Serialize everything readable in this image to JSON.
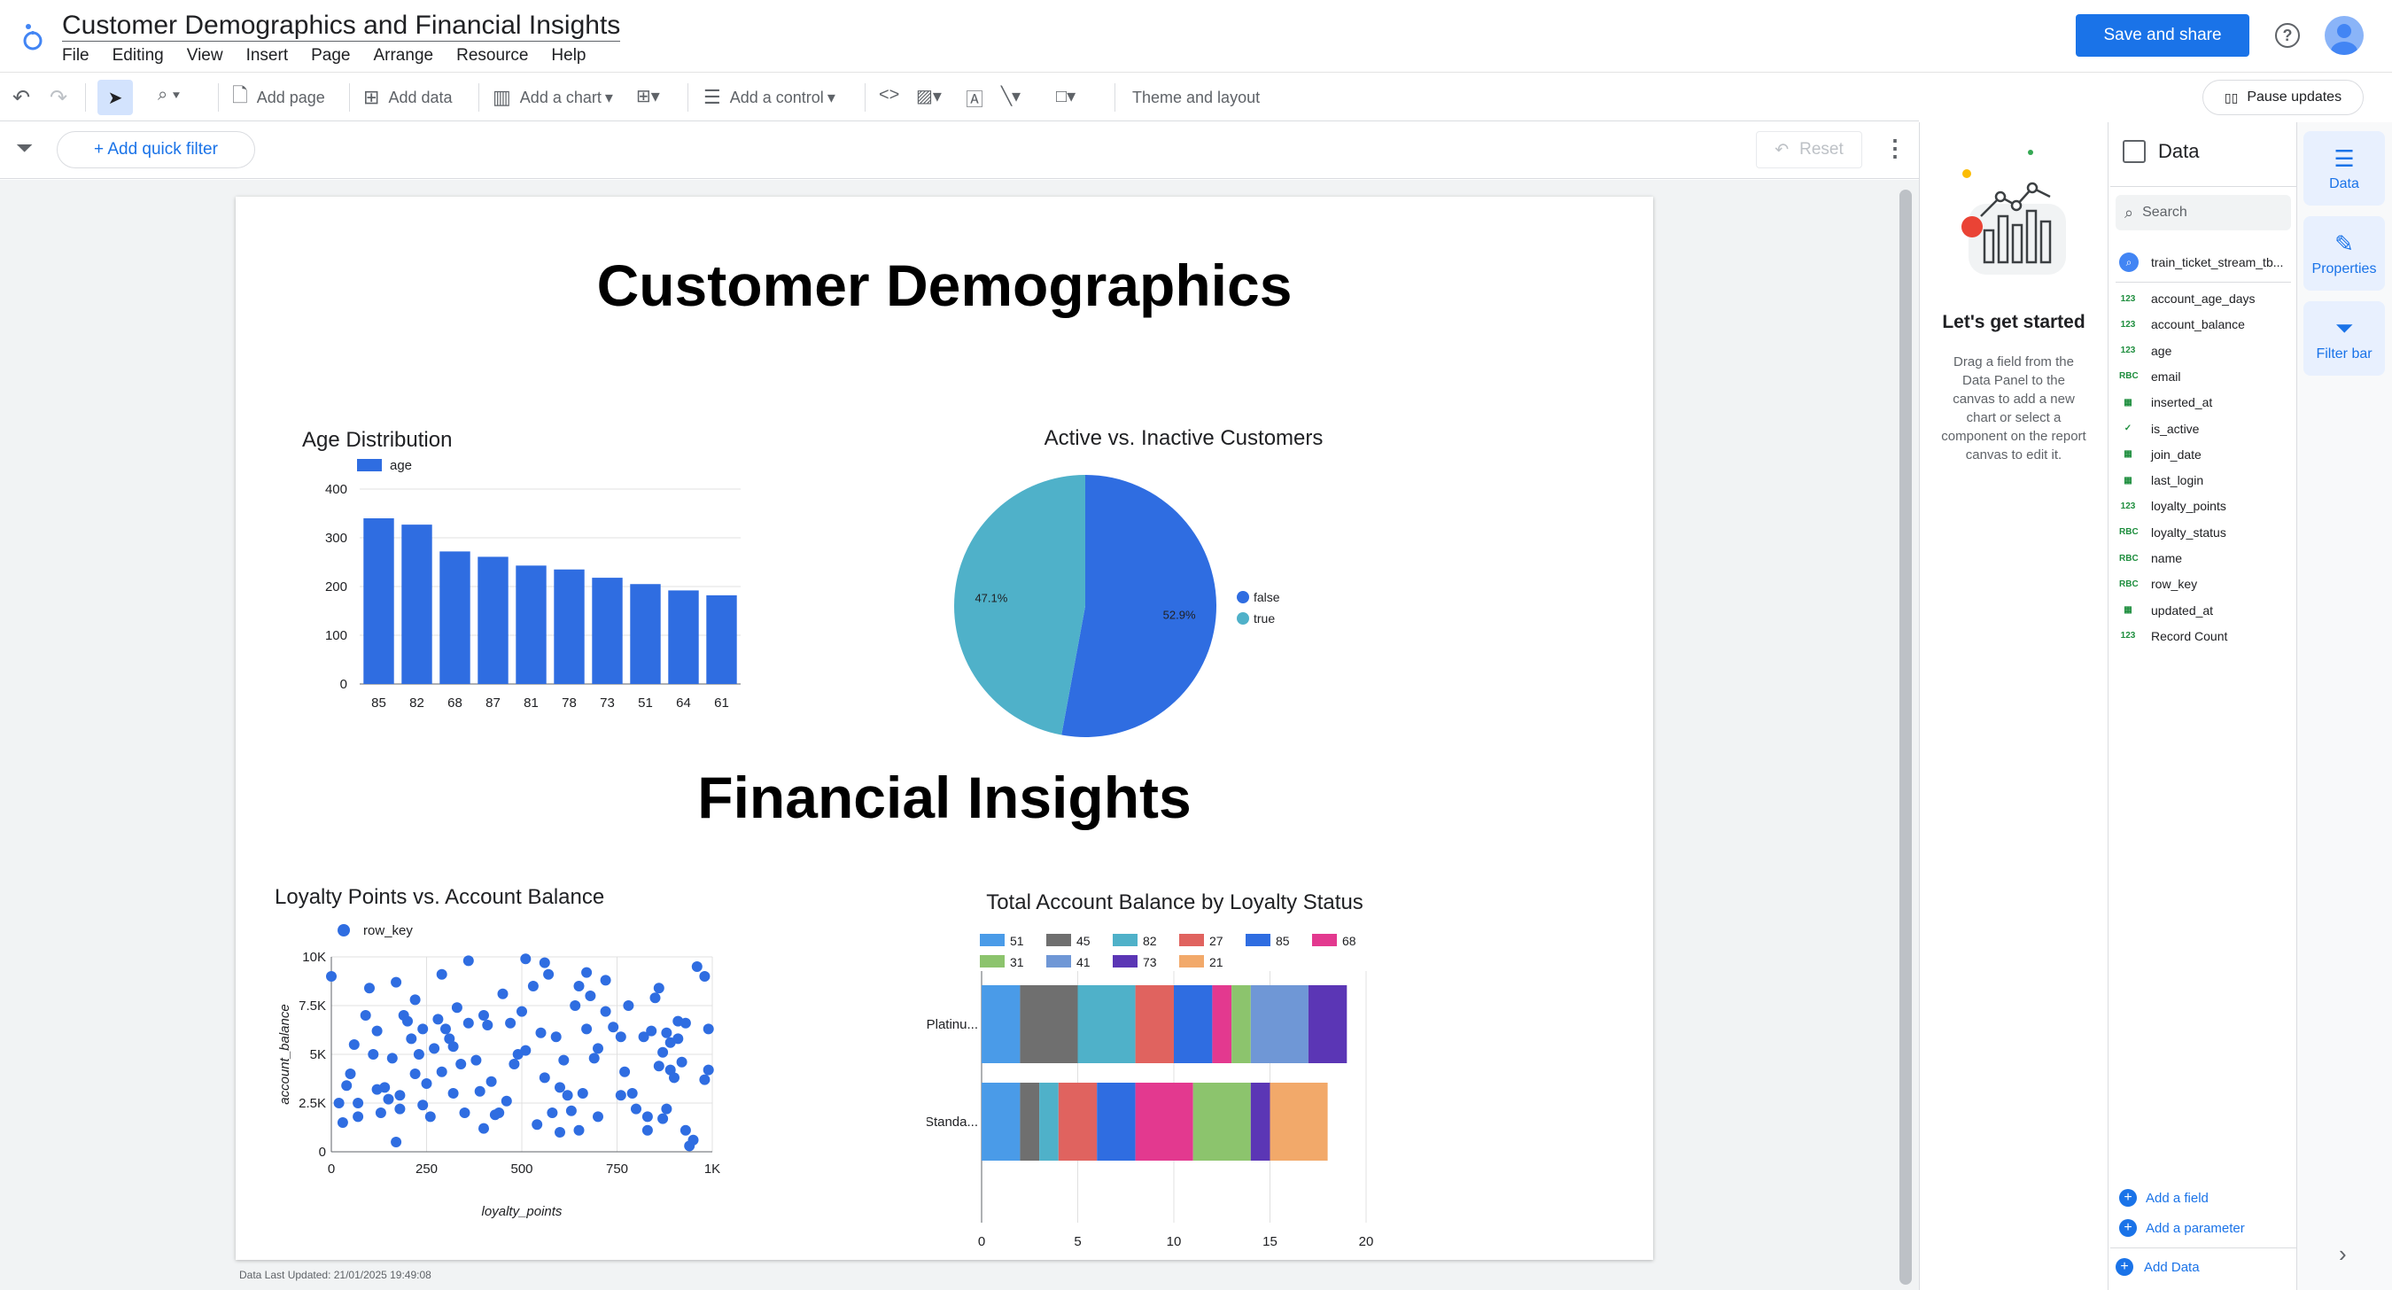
{
  "app": {
    "title": "Customer Demographics and Financial Insights",
    "menu": [
      "File",
      "Editing",
      "View",
      "Insert",
      "Page",
      "Arrange",
      "Resource",
      "Help"
    ],
    "save_share": "Save and share"
  },
  "toolbar": {
    "add_page": "Add page",
    "add_data": "Add data",
    "add_chart": "Add a chart",
    "add_control": "Add a control",
    "theme_layout": "Theme and layout",
    "pause_updates": "Pause updates",
    "add_quick_filter": "+ Add quick filter",
    "reset": "Reset"
  },
  "report": {
    "heading1": "Customer Demographics",
    "heading2": "Financial Insights",
    "footer": "Data Last Updated: 21/01/2025 19:49:08"
  },
  "chart_data": [
    {
      "type": "bar",
      "title": "Age Distribution",
      "legend": "age",
      "categories": [
        "85",
        "82",
        "68",
        "87",
        "81",
        "78",
        "73",
        "51",
        "64",
        "61"
      ],
      "values": [
        340,
        327,
        272,
        261,
        243,
        235,
        218,
        205,
        192,
        182
      ],
      "ylim": [
        0,
        400
      ],
      "yticks": [
        "0",
        "100",
        "200",
        "300",
        "400"
      ],
      "color": "#2f6de1"
    },
    {
      "type": "pie",
      "title": "Active vs. Inactive Customers",
      "slices": [
        {
          "name": "false",
          "value": 52.9,
          "label": "52.9%",
          "color": "#2f6de1"
        },
        {
          "name": "true",
          "value": 47.1,
          "label": "47.1%",
          "color": "#4fb1c9"
        }
      ]
    },
    {
      "type": "scatter",
      "title": "Loyalty Points vs. Account Balance",
      "legend": "row_key",
      "xlabel": "loyalty_points",
      "ylabel": "account_balance",
      "xlim": [
        0,
        1000
      ],
      "ylim": [
        0,
        10000
      ],
      "xticks": [
        "0",
        "250",
        "500",
        "750",
        "1K"
      ],
      "yticks": [
        "0",
        "2.5K",
        "5K",
        "7.5K",
        "10K"
      ],
      "color": "#2f6de1",
      "points": [
        [
          0,
          9000
        ],
        [
          20,
          2500
        ],
        [
          30,
          1500
        ],
        [
          40,
          3400
        ],
        [
          50,
          4000
        ],
        [
          60,
          5500
        ],
        [
          70,
          1800
        ],
        [
          90,
          7000
        ],
        [
          110,
          5000
        ],
        [
          120,
          6200
        ],
        [
          120,
          3200
        ],
        [
          130,
          2000
        ],
        [
          140,
          3300
        ],
        [
          160,
          4800
        ],
        [
          170,
          8700
        ],
        [
          170,
          500
        ],
        [
          180,
          2900
        ],
        [
          180,
          2200
        ],
        [
          190,
          7000
        ],
        [
          200,
          6700
        ],
        [
          210,
          5800
        ],
        [
          220,
          7800
        ],
        [
          220,
          4000
        ],
        [
          230,
          5000
        ],
        [
          240,
          6300
        ],
        [
          240,
          2400
        ],
        [
          250,
          3500
        ],
        [
          260,
          1800
        ],
        [
          270,
          5300
        ],
        [
          280,
          6800
        ],
        [
          290,
          4100
        ],
        [
          290,
          9100
        ],
        [
          300,
          6300
        ],
        [
          310,
          5800
        ],
        [
          320,
          3000
        ],
        [
          320,
          5400
        ],
        [
          330,
          7400
        ],
        [
          340,
          4500
        ],
        [
          350,
          2000
        ],
        [
          360,
          6600
        ],
        [
          360,
          9800
        ],
        [
          380,
          4700
        ],
        [
          390,
          3100
        ],
        [
          400,
          1200
        ],
        [
          400,
          7000
        ],
        [
          410,
          6500
        ],
        [
          420,
          3600
        ],
        [
          430,
          1900
        ],
        [
          440,
          2000
        ],
        [
          450,
          8100
        ],
        [
          460,
          2600
        ],
        [
          470,
          6600
        ],
        [
          480,
          4500
        ],
        [
          490,
          5000
        ],
        [
          500,
          7200
        ],
        [
          510,
          5200
        ],
        [
          510,
          9900
        ],
        [
          530,
          8500
        ],
        [
          540,
          1400
        ],
        [
          550,
          6100
        ],
        [
          560,
          9700
        ],
        [
          560,
          3800
        ],
        [
          570,
          9100
        ],
        [
          580,
          2000
        ],
        [
          590,
          5900
        ],
        [
          600,
          3300
        ],
        [
          600,
          1000
        ],
        [
          610,
          4700
        ],
        [
          620,
          2900
        ],
        [
          630,
          2100
        ],
        [
          640,
          7500
        ],
        [
          650,
          8500
        ],
        [
          650,
          1100
        ],
        [
          660,
          3000
        ],
        [
          670,
          6300
        ],
        [
          670,
          9200
        ],
        [
          680,
          8000
        ],
        [
          690,
          4800
        ],
        [
          700,
          5300
        ],
        [
          700,
          1800
        ],
        [
          720,
          8800
        ],
        [
          720,
          7200
        ],
        [
          740,
          6400
        ],
        [
          760,
          5900
        ],
        [
          760,
          2900
        ],
        [
          770,
          4100
        ],
        [
          780,
          7500
        ],
        [
          790,
          3000
        ],
        [
          800,
          2200
        ],
        [
          820,
          5900
        ],
        [
          830,
          1100
        ],
        [
          830,
          1800
        ],
        [
          840,
          6200
        ],
        [
          850,
          7900
        ],
        [
          860,
          8400
        ],
        [
          860,
          4400
        ],
        [
          870,
          5100
        ],
        [
          870,
          1700
        ],
        [
          880,
          6100
        ],
        [
          880,
          2200
        ],
        [
          890,
          5600
        ],
        [
          890,
          4200
        ],
        [
          900,
          3800
        ],
        [
          910,
          6700
        ],
        [
          910,
          5800
        ],
        [
          920,
          4600
        ],
        [
          930,
          6600
        ],
        [
          930,
          1100
        ],
        [
          940,
          300
        ],
        [
          950,
          600
        ],
        [
          960,
          9500
        ],
        [
          980,
          3700
        ],
        [
          990,
          6300
        ],
        [
          990,
          4200
        ],
        [
          980,
          9000
        ],
        [
          70,
          2500
        ],
        [
          100,
          8400
        ],
        [
          150,
          2700
        ]
      ]
    },
    {
      "type": "bar",
      "orientation": "horizontal-stacked",
      "title": "Total Account Balance by Loyalty Status",
      "categories": [
        "Platinu...",
        "Standa..."
      ],
      "xlim": [
        0,
        20
      ],
      "xticks": [
        "0",
        "5",
        "10",
        "15",
        "20"
      ],
      "series": [
        {
          "name": "51",
          "color": "#4a9be8",
          "values": [
            2,
            2
          ]
        },
        {
          "name": "45",
          "color": "#6f6f6f",
          "values": [
            3,
            1
          ]
        },
        {
          "name": "82",
          "color": "#4fb1c9",
          "values": [
            3,
            1
          ]
        },
        {
          "name": "27",
          "color": "#e0635f",
          "values": [
            2,
            2
          ]
        },
        {
          "name": "85",
          "color": "#2f6de1",
          "values": [
            2,
            2
          ]
        },
        {
          "name": "68",
          "color": "#e3398f",
          "values": [
            1,
            3
          ]
        },
        {
          "name": "31",
          "color": "#8cc46d",
          "values": [
            1,
            3
          ]
        },
        {
          "name": "41",
          "color": "#6f97d6",
          "values": [
            3,
            0
          ]
        },
        {
          "name": "73",
          "color": "#5b36b5",
          "values": [
            2,
            1
          ]
        },
        {
          "name": "21",
          "color": "#f2a96a",
          "values": [
            0,
            3
          ]
        }
      ]
    }
  ],
  "right_panel": {
    "lets_get_started": "Let's get started",
    "help_text": "Drag a field from the Data Panel to the canvas to add a new chart or select a component on the report canvas to edit it.",
    "data_title": "Data",
    "search_placeholder": "Search",
    "datasource": "train_ticket_stream_tb...",
    "fields": [
      {
        "type": "123",
        "name": "account_age_days"
      },
      {
        "type": "123",
        "name": "account_balance"
      },
      {
        "type": "123",
        "name": "age"
      },
      {
        "type": "RBC",
        "name": "email"
      },
      {
        "type": "cal",
        "name": "inserted_at"
      },
      {
        "type": "bool",
        "name": "is_active"
      },
      {
        "type": "cal",
        "name": "join_date"
      },
      {
        "type": "cal",
        "name": "last_login"
      },
      {
        "type": "123",
        "name": "loyalty_points"
      },
      {
        "type": "RBC",
        "name": "loyalty_status"
      },
      {
        "type": "RBC",
        "name": "name"
      },
      {
        "type": "RBC",
        "name": "row_key"
      },
      {
        "type": "cal",
        "name": "updated_at"
      },
      {
        "type": "123",
        "name": "Record Count"
      }
    ],
    "add_field": "Add a field",
    "add_parameter": "Add a parameter",
    "add_data": "Add Data"
  },
  "rail": {
    "data": "Data",
    "properties": "Properties",
    "filter_bar": "Filter bar"
  }
}
